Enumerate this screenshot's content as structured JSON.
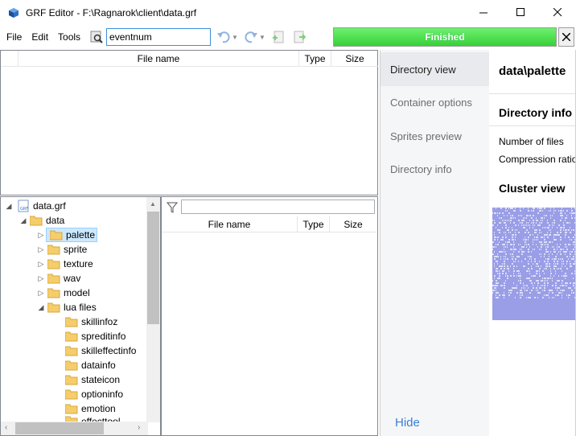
{
  "window": {
    "title": "GRF Editor - F:\\Ragnarok\\client\\data.grf"
  },
  "menu": {
    "file": "File",
    "edit": "Edit",
    "tools": "Tools"
  },
  "search": {
    "value": "eventnum"
  },
  "progress": {
    "label": "Finished",
    "value": 1.0
  },
  "top_grid": {
    "columns": [
      "File name",
      "Type",
      "Size"
    ]
  },
  "files_grid": {
    "columns": [
      "File name",
      "Type",
      "Size"
    ],
    "filter_value": ""
  },
  "tree": {
    "root": "data.grf",
    "data": "data",
    "items": [
      "palette",
      "sprite",
      "texture",
      "wav",
      "model",
      "lua files"
    ],
    "lua_children": [
      "skillinfoz",
      "spreditinfo",
      "skilleffectinfo",
      "datainfo",
      "stateicon",
      "optioninfo",
      "emotion",
      "effecttool"
    ],
    "selected": "palette"
  },
  "side_nav": {
    "items": [
      "Directory view",
      "Container options",
      "Sprites preview",
      "Directory info"
    ],
    "active": "Directory view",
    "hide": "Hide"
  },
  "detail": {
    "title": "data\\palette",
    "section_info": "Directory info",
    "number_of_files": "Number of files",
    "compression_ratio": "Compression ratio",
    "section_cluster": "Cluster view"
  },
  "colors": {
    "accent": "#3a7fd5",
    "progress": "#4fdc4f",
    "cluster": "#9a9ee6",
    "folder": "#f5cd6a"
  }
}
